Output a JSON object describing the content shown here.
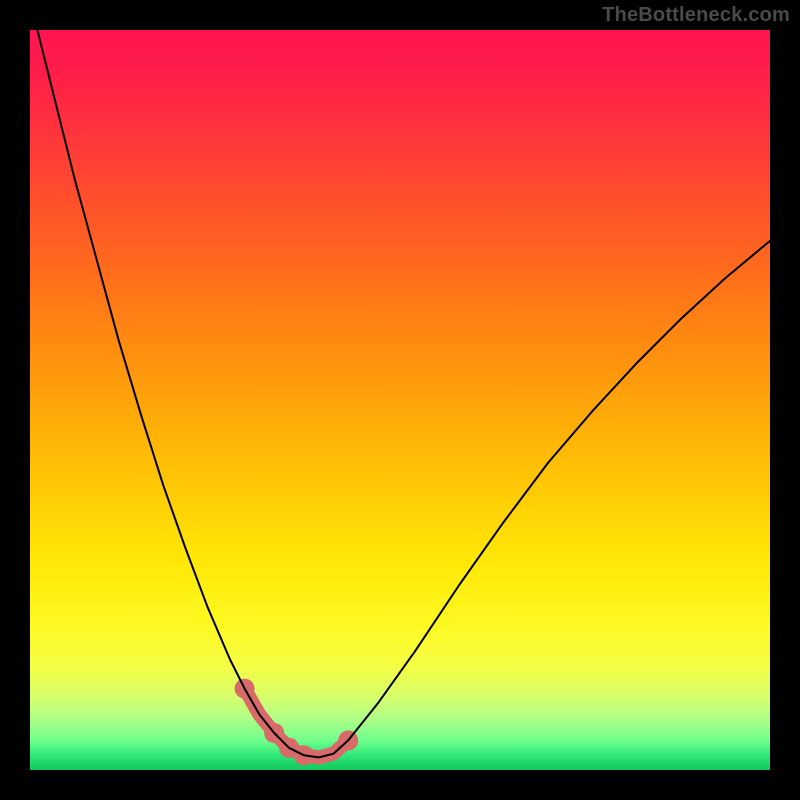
{
  "watermark": "TheBottleneck.com",
  "chart_data": {
    "type": "line",
    "title": "",
    "xlabel": "",
    "ylabel": "",
    "xlim": [
      0,
      100
    ],
    "ylim": [
      0,
      100
    ],
    "grid": false,
    "legend": false,
    "series": [
      {
        "name": "curve",
        "x": [
          0,
          3,
          6,
          9,
          12,
          15,
          18,
          21,
          24,
          27,
          29,
          31,
          33,
          35,
          37,
          39,
          41,
          43,
          47,
          52,
          58,
          64,
          70,
          76,
          82,
          88,
          94,
          100
        ],
        "y": [
          104,
          92,
          80,
          69,
          58,
          48,
          38.5,
          30,
          22,
          15,
          11,
          7.5,
          5,
          3,
          2,
          1.7,
          2.2,
          4,
          9,
          16,
          25,
          33.5,
          41.5,
          48.5,
          55,
          61,
          66.5,
          71.5
        ],
        "stroke": "#000000",
        "stroke_width": 2
      },
      {
        "name": "highlight",
        "x": [
          29,
          31,
          33,
          35,
          37,
          39,
          41,
          43
        ],
        "y": [
          11,
          7.5,
          5,
          3,
          2,
          1.7,
          2.2,
          4
        ],
        "stroke": "#d86a6a",
        "stroke_width": 14
      }
    ],
    "highlight_points": {
      "x": [
        29,
        33,
        35,
        37,
        43
      ],
      "y": [
        11,
        5,
        3,
        2,
        4
      ],
      "r": 10,
      "fill": "#d86a6a"
    },
    "background_gradient": {
      "stops": [
        {
          "offset": 0.0,
          "color": "#ff1450"
        },
        {
          "offset": 0.06,
          "color": "#ff1e4a"
        },
        {
          "offset": 0.18,
          "color": "#ff4034"
        },
        {
          "offset": 0.3,
          "color": "#ff6420"
        },
        {
          "offset": 0.42,
          "color": "#ff8a10"
        },
        {
          "offset": 0.54,
          "color": "#ffb008"
        },
        {
          "offset": 0.64,
          "color": "#ffd004"
        },
        {
          "offset": 0.72,
          "color": "#ffe808"
        },
        {
          "offset": 0.8,
          "color": "#fff820"
        },
        {
          "offset": 0.86,
          "color": "#f4ff44"
        },
        {
          "offset": 0.9,
          "color": "#d8ff6a"
        },
        {
          "offset": 0.93,
          "color": "#b0ff88"
        },
        {
          "offset": 0.96,
          "color": "#70ff8c"
        },
        {
          "offset": 0.98,
          "color": "#30e878"
        },
        {
          "offset": 1.0,
          "color": "#10c85c"
        }
      ]
    }
  }
}
